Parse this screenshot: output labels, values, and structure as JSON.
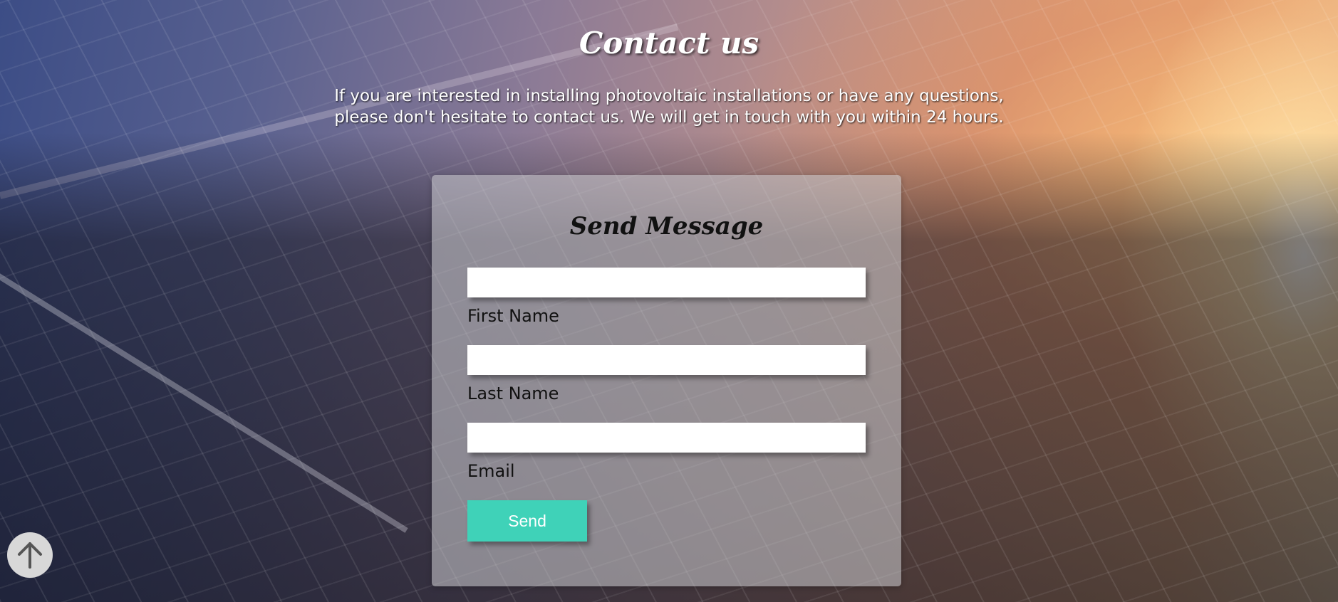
{
  "page": {
    "heading": "Contact us",
    "intro": "If you are interested in installing photovoltaic installations or have any questions, please don't hesitate to contact us. We will get in touch with you within 24 hours."
  },
  "form": {
    "title": "Send Message",
    "fields": [
      {
        "label": "First Name",
        "value": "",
        "placeholder": ""
      },
      {
        "label": "Last Name",
        "value": "",
        "placeholder": ""
      },
      {
        "label": "Email",
        "value": "",
        "placeholder": ""
      }
    ],
    "submit_label": "Send"
  },
  "icons": {
    "scroll_top": "arrow-up-icon"
  },
  "colors": {
    "accent": "#3fd2b8",
    "card": "rgba(205,205,210,0.55)",
    "scroll_button": "#d8d8d8"
  }
}
